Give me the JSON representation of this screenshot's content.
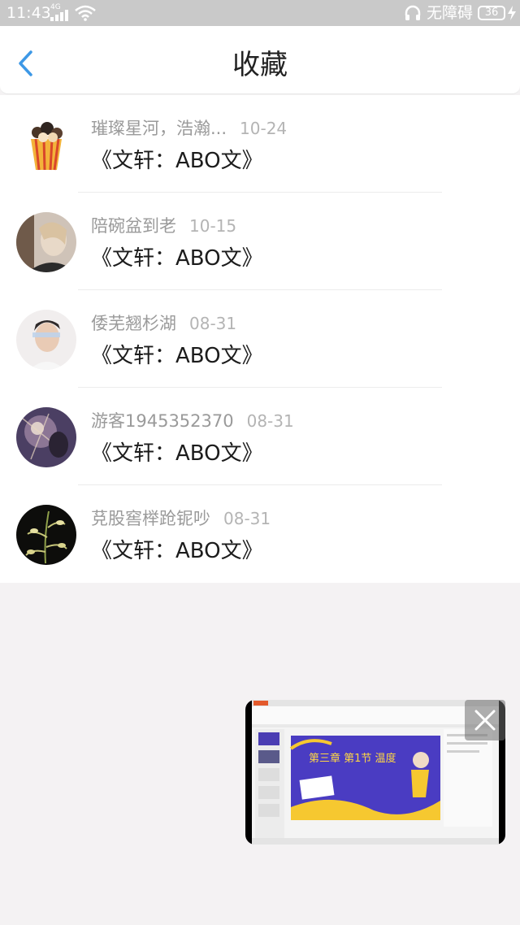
{
  "status_bar": {
    "time": "11:43",
    "network": "4G",
    "accessibility_label": "无障碍",
    "battery": "36"
  },
  "header": {
    "title": "收藏"
  },
  "items": [
    {
      "name": "璀璨星河，浩瀚...",
      "date": "10-24",
      "title": "《文轩：ABO文》"
    },
    {
      "name": "陪碗盆到老",
      "date": "10-15",
      "title": "《文轩：ABO文》"
    },
    {
      "name": "倭芜翘杉湖",
      "date": "08-31",
      "title": "《文轩：ABO文》"
    },
    {
      "name": "游客1945352370",
      "date": "08-31",
      "title": "《文轩：ABO文》"
    },
    {
      "name": "莌股窖榉跄铌吵",
      "date": "08-31",
      "title": "《文轩：ABO文》"
    }
  ],
  "float_window": {
    "slide_text": "第三章 第1节 温度"
  }
}
